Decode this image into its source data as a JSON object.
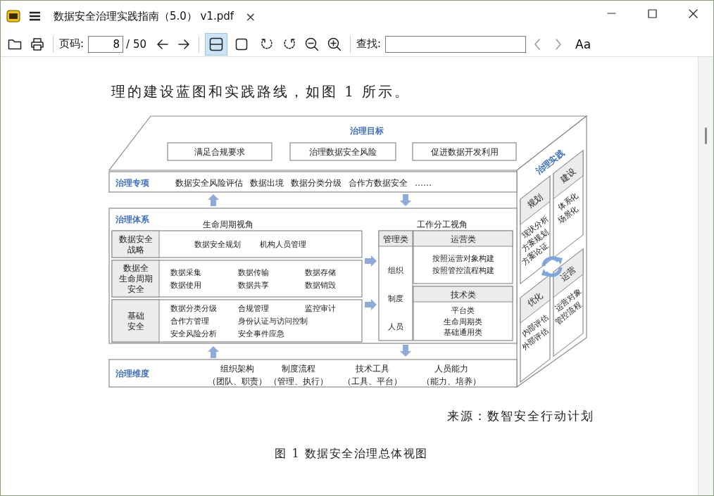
{
  "window": {
    "title": "数据安全治理实践指南（5.0） v1.pdf",
    "close_tab": "×"
  },
  "toolbar": {
    "page_label": "页码:",
    "page_value": "8",
    "page_total": "/ 50",
    "view_modes": [
      {
        "kind": "fit-width",
        "selected": true
      },
      {
        "kind": "single-page",
        "selected": false
      }
    ],
    "find_label": "查找:",
    "font_button": "Aa"
  },
  "document": {
    "intro": "理的建设蓝图和实践路线，如图 1 所示。",
    "figure": {
      "goals": {
        "title": "治理目标",
        "items": [
          "满足合规要求",
          "治理数据安全风险",
          "促进数据开发利用"
        ]
      },
      "topics": {
        "title": "治理专项",
        "items": [
          "数据安全风险评估",
          "数据出境",
          "数据分类分级",
          "合作方数据安全",
          "……"
        ]
      },
      "system": {
        "title": "治理体系",
        "lifecycle_title": "生命周期视角",
        "division_title": "工作分工视角",
        "lifecycle_rows": [
          {
            "heading": [
              "数据安全",
              "战略"
            ],
            "items": [
              [
                "数据安全规划",
                "机构人员管理"
              ]
            ]
          },
          {
            "heading": [
              "数据全",
              "生命周期",
              "安全"
            ],
            "items": [
              [
                "数据采集",
                "数据传输",
                "数据存储"
              ],
              [
                "数据使用",
                "数据共享",
                "数据销毁"
              ]
            ]
          },
          {
            "heading": [
              "基础",
              "安全"
            ],
            "items": [
              [
                "数据分类分级",
                "合规管理",
                "监控审计"
              ],
              [
                "合作方管理",
                "身份认证与访问控制"
              ],
              [
                "安全风险分析",
                "安全事件应急"
              ]
            ]
          }
        ],
        "management": {
          "title": "管理类",
          "items": [
            "组织",
            "制度",
            "人员"
          ]
        },
        "operations": {
          "title": "运营类",
          "items": [
            "按照运营对象构建",
            "按照管控流程构建"
          ]
        },
        "technology": {
          "title": "技术类",
          "items": [
            "平台类",
            "生命周期类",
            "基础通用类"
          ]
        }
      },
      "dimensions": {
        "title": "治理维度",
        "items": [
          {
            "name": "组织架构",
            "detail": "（团队、职责）"
          },
          {
            "name": "制度流程",
            "detail": "（管理、执行）"
          },
          {
            "name": "技术工具",
            "detail": "（工具、平台）"
          },
          {
            "name": "人员能力",
            "detail": "（能力、培养）"
          }
        ]
      },
      "practice": {
        "title": "治理实践",
        "stages": [
          {
            "title": "规划",
            "items": [
              "现状分析",
              "方案规划",
              "方案论证"
            ]
          },
          {
            "title": "建设",
            "items": [
              "体系化",
              "场景化"
            ]
          },
          {
            "title": "优化",
            "items": [
              "内部评估",
              "外部评估"
            ]
          },
          {
            "title": "运营",
            "items": [
              "运营对象",
              "管控流程"
            ]
          }
        ]
      }
    },
    "source": "来源：数智安全行动计划",
    "caption": "图 1 数据安全治理总体视图"
  }
}
